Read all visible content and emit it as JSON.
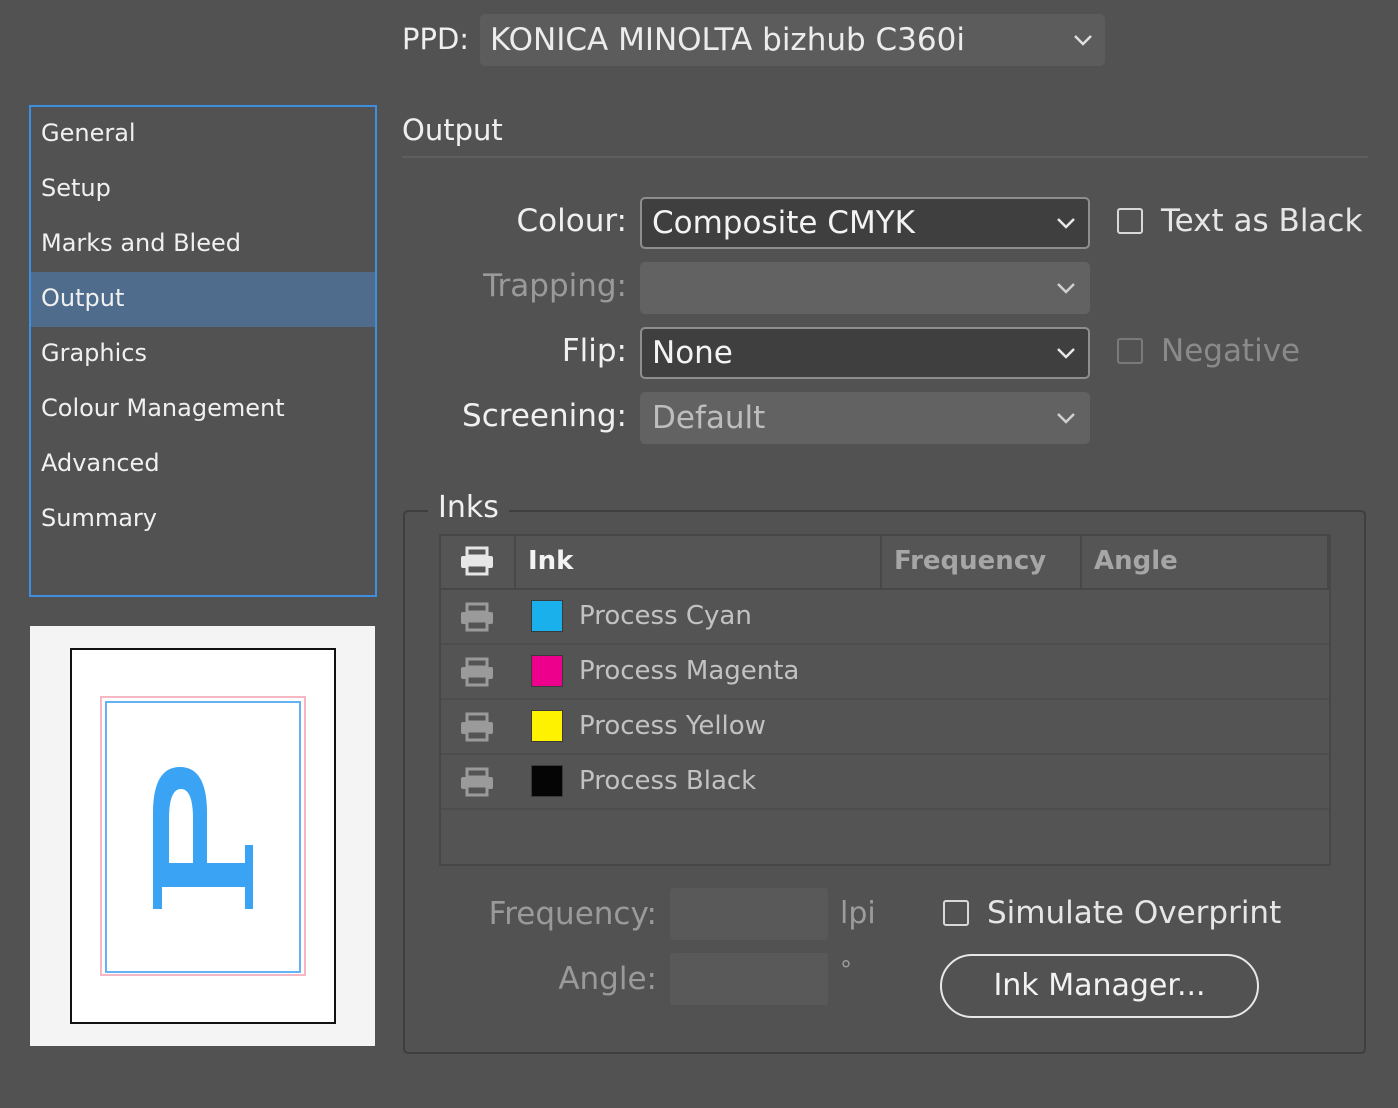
{
  "ppd": {
    "label": "PPD:",
    "value": "KONICA MINOLTA bizhub C360i"
  },
  "sidebar": {
    "items": [
      {
        "label": "General"
      },
      {
        "label": "Setup"
      },
      {
        "label": "Marks and Bleed"
      },
      {
        "label": "Output"
      },
      {
        "label": "Graphics"
      },
      {
        "label": "Colour Management"
      },
      {
        "label": "Advanced"
      },
      {
        "label": "Summary"
      }
    ],
    "selected": "Output"
  },
  "section": {
    "title": "Output"
  },
  "form": {
    "colour": {
      "label": "Colour:",
      "value": "Composite CMYK"
    },
    "trapping": {
      "label": "Trapping:",
      "value": ""
    },
    "flip": {
      "label": "Flip:",
      "value": "None"
    },
    "screening": {
      "label": "Screening:",
      "value": "Default"
    },
    "text_as_black": {
      "label": "Text as Black",
      "checked": false
    },
    "negative": {
      "label": "Negative",
      "checked": false
    }
  },
  "inks": {
    "legend": "Inks",
    "columns": {
      "ink": "Ink",
      "frequency": "Frequency",
      "angle": "Angle"
    },
    "rows": [
      {
        "name": "Process Cyan",
        "color": "#1ab0ec"
      },
      {
        "name": "Process Magenta",
        "color": "#ec008c"
      },
      {
        "name": "Process Yellow",
        "color": "#fff200"
      },
      {
        "name": "Process Black",
        "color": "#050505"
      }
    ],
    "frequency": {
      "label": "Frequency:",
      "value": "",
      "unit": "lpi"
    },
    "angle": {
      "label": "Angle:",
      "value": "",
      "unit": "°"
    },
    "simulate_overprint": {
      "label": "Simulate Overprint",
      "checked": false
    },
    "ink_manager_label": "Ink Manager..."
  },
  "preview": {
    "page_color": "#ffffff",
    "bleed_color": "#f4b7c3",
    "trim_color": "#64b2f2",
    "glyph_color": "#3aa3f3"
  }
}
